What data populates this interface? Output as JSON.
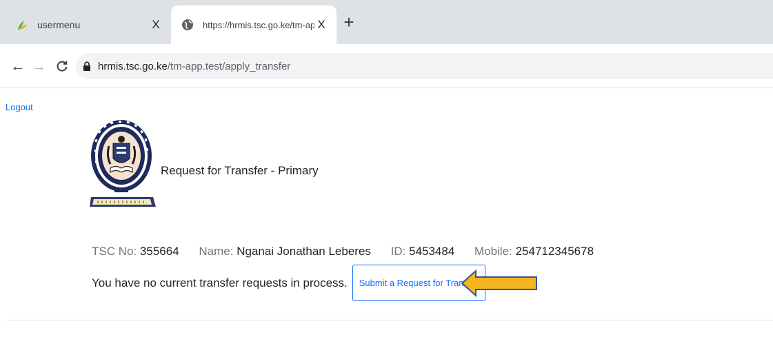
{
  "browser": {
    "tabs": [
      {
        "title": "usermenu",
        "close": "X"
      },
      {
        "title": "https://hrmis.tsc.go.ke/tm-app.te",
        "close": "X"
      }
    ],
    "new_tab": "+",
    "address": {
      "host": "hrmis.tsc.go.ke",
      "path": "/tm-app.test/apply_transfer"
    },
    "nav": {
      "back": "←",
      "forward": "→",
      "reload": "C"
    }
  },
  "page": {
    "logout": "Logout",
    "title": "Request for Transfer - Primary",
    "teacher": {
      "tsc_label": "TSC No:",
      "tsc_value": "355664",
      "name_label": "Name:",
      "name_value": "Nganai Jonathan Leberes",
      "id_label": "ID:",
      "id_value": "5453484",
      "mobile_label": "Mobile:",
      "mobile_value": "254712345678"
    },
    "status_message": "You have no current transfer requests in process.",
    "submit_button": "Submit a Request for Transfer"
  },
  "colors": {
    "link_blue": "#0d6efd",
    "arrow_fill": "#f5b51c",
    "arrow_stroke": "#2f55a4"
  },
  "icons": [
    "leaf-favicon",
    "globe-icon",
    "lock-icon",
    "tsc-logo",
    "arrow-pointer-icon"
  ]
}
